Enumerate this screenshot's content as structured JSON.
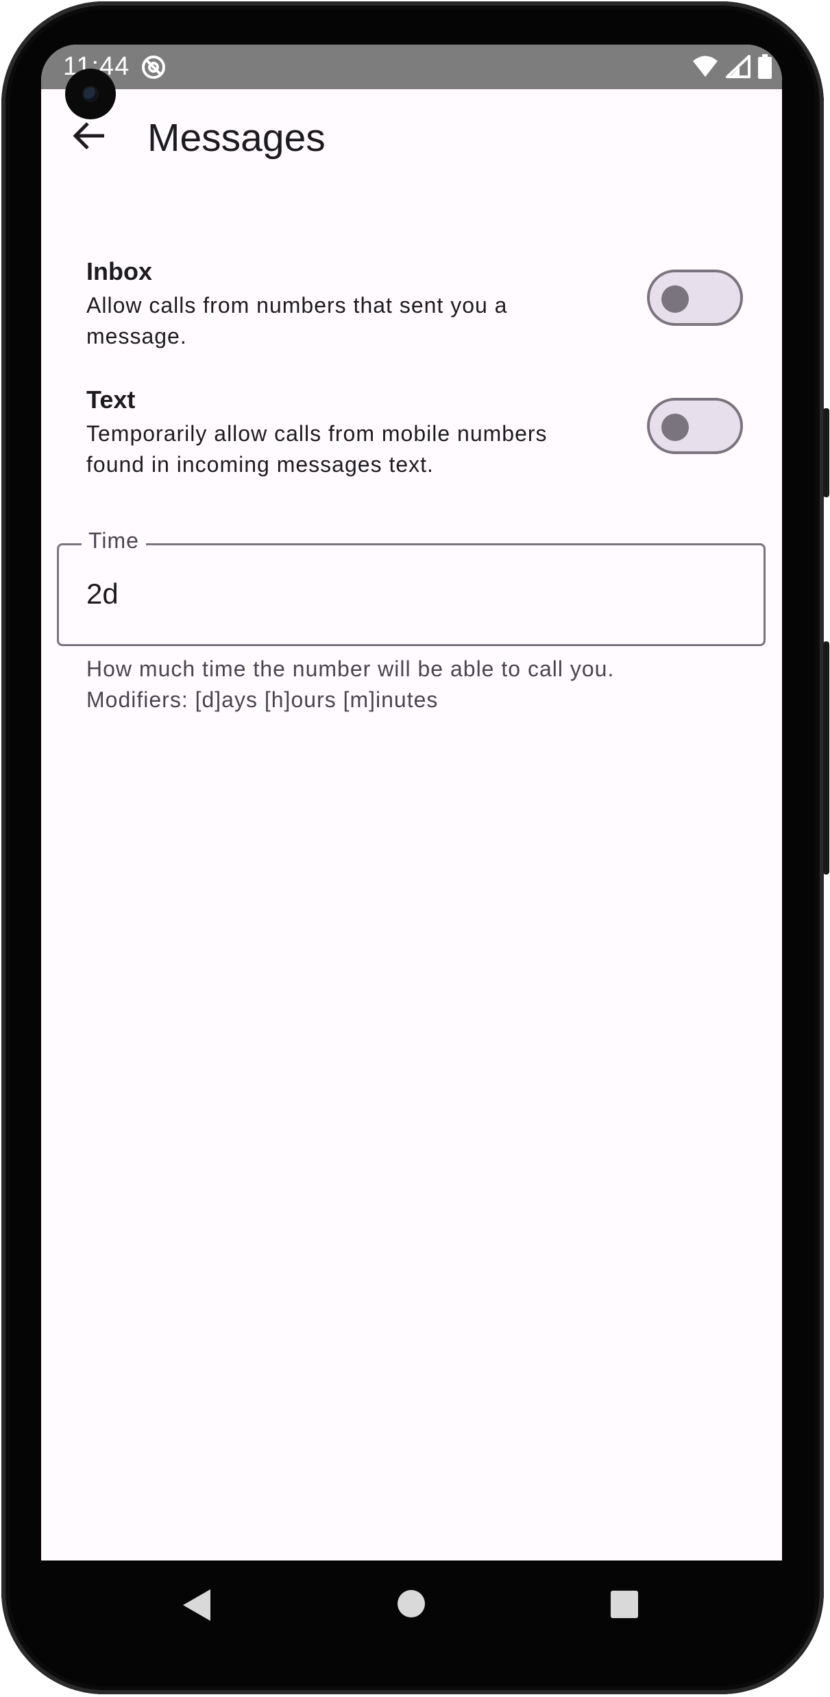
{
  "status_bar": {
    "time": "11:44",
    "dnd_icon": "do-not-disturb-icon",
    "wifi_icon": "wifi-icon",
    "signal_icon": "signal-icon",
    "battery_icon": "battery-icon"
  },
  "app_bar": {
    "back_icon": "arrow-back-icon",
    "title": "Messages"
  },
  "settings": [
    {
      "title": "Inbox",
      "description": "Allow calls from numbers that sent you a message.",
      "enabled": false
    },
    {
      "title": "Text",
      "description": "Temporarily allow calls from mobile numbers found in incoming messages text.",
      "enabled": false
    }
  ],
  "time_field": {
    "label": "Time",
    "value": "2d",
    "helper_line1": "How much time the number will be able to call you.",
    "helper_line2": "Modifiers: [d]ays [h]ours [m]inutes"
  },
  "nav_bar": {
    "back_icon": "nav-back-icon",
    "home_icon": "nav-home-icon",
    "recents_icon": "nav-recents-icon"
  },
  "colors": {
    "background": "#fffbfe",
    "status_bar": "#7d7d7d",
    "switch_track": "#e7e0ec",
    "switch_outline": "#79747e",
    "text_primary": "#1c1b1f",
    "text_secondary": "#49454f"
  }
}
